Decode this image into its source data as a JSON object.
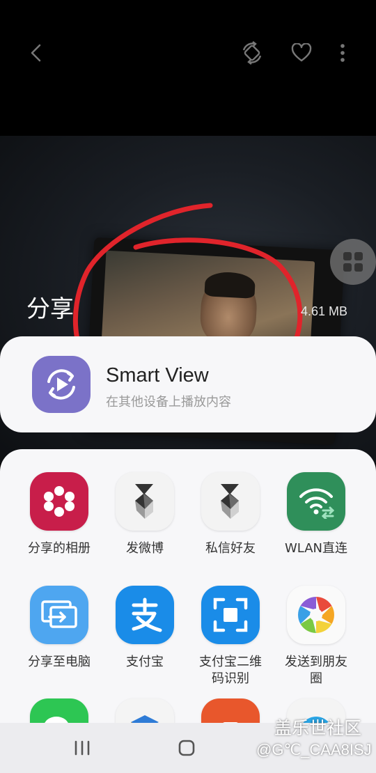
{
  "toolbar": {
    "back_icon": "chevron-left-icon",
    "rotate_icon": "rotate-screen-icon",
    "favorite_icon": "heart-outline-icon",
    "more_icon": "more-vertical-icon"
  },
  "share_header": {
    "title": "分享",
    "file_size": "4.61 MB"
  },
  "smart_view": {
    "title": "Smart View",
    "subtitle": "在其他设备上播放内容",
    "icon": "smart-view-icon"
  },
  "apps": [
    {
      "label": "分享的相册",
      "icon": "shared-album-icon"
    },
    {
      "label": "发微博",
      "icon": "weibo-s-icon"
    },
    {
      "label": "私信好友",
      "icon": "weibo-s-icon"
    },
    {
      "label": "WLAN直连",
      "icon": "wifi-direct-icon"
    },
    {
      "label": "分享至电脑",
      "icon": "share-to-pc-icon"
    },
    {
      "label": "支付宝",
      "icon": "alipay-icon"
    },
    {
      "label": "支付宝二维\n码识别",
      "icon": "alipay-scan-icon"
    },
    {
      "label": "发送到朋友\n圈",
      "icon": "moments-icon"
    }
  ],
  "watermark": {
    "brand": "盖乐世社区",
    "user": "@G℃_CAA8ISJ"
  },
  "colors": {
    "scribble": "#e0242b",
    "smart_view_bg": "#7b72c8",
    "album_bg": "#c81e4a",
    "wlan_bg": "#2f8f5a",
    "alipay_bg": "#1a8ce8",
    "pc_bg": "#4ea6f0"
  }
}
